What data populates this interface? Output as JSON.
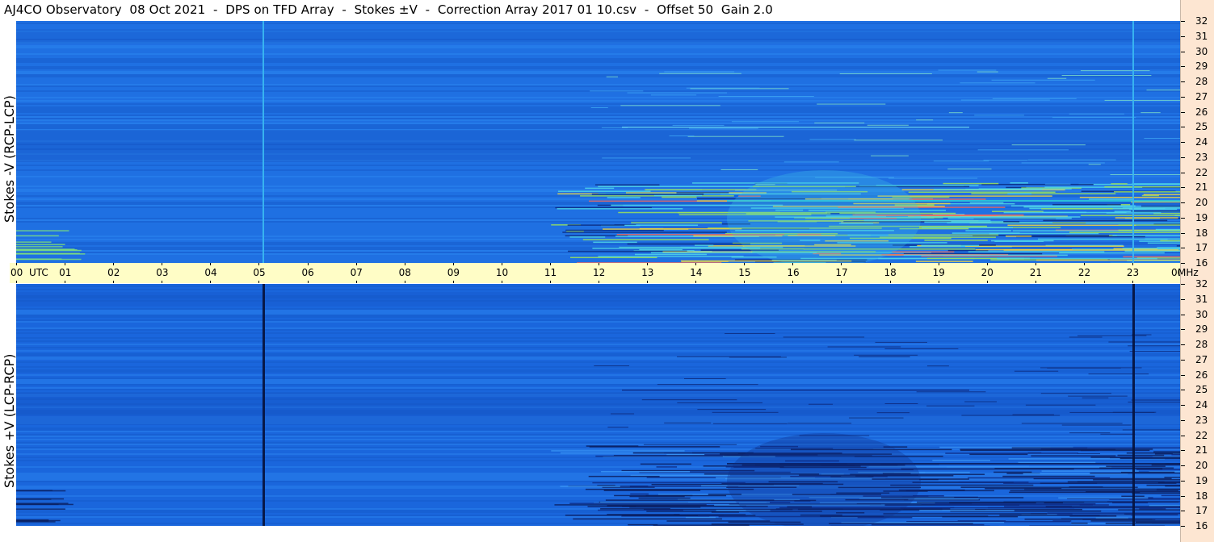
{
  "title": "AJ4CO Observatory  08 Oct 2021  -  DPS on TFD Array  -  Stokes ±V  -  Correction Array 2017 01 10.csv  -  Offset 50  Gain 2.0",
  "colors": {
    "background": "#1e6fe0",
    "axis_band": "#fffdc6",
    "right_axis": "#fde6d2"
  },
  "chart_data": [
    {
      "type": "heatmap",
      "panel": "top",
      "ylabel": "Stokes -V (RCP-LCP)",
      "x_range": [
        0,
        24
      ],
      "y_range": [
        16,
        32
      ],
      "freq_ticks": [
        "32",
        "31",
        "30",
        "29",
        "28",
        "27",
        "26",
        "25",
        "24",
        "23",
        "22",
        "21",
        "20",
        "19",
        "18",
        "17",
        "16"
      ]
    },
    {
      "type": "heatmap",
      "panel": "bottom",
      "ylabel": "Stokes +V (LCP-RCP)",
      "x_range": [
        0,
        24
      ],
      "y_range": [
        16,
        32
      ],
      "freq_ticks": [
        "32",
        "31",
        "30",
        "29",
        "28",
        "27",
        "26",
        "25",
        "24",
        "23",
        "22",
        "21",
        "20",
        "19",
        "18",
        "17",
        "16"
      ]
    }
  ],
  "time_axis": {
    "unit_label": "UTC",
    "freq_unit": "MHz",
    "ticks": [
      "00",
      "01",
      "02",
      "03",
      "04",
      "05",
      "06",
      "07",
      "08",
      "09",
      "10",
      "11",
      "12",
      "13",
      "14",
      "15",
      "16",
      "17",
      "18",
      "19",
      "20",
      "21",
      "22",
      "23",
      "00"
    ]
  }
}
